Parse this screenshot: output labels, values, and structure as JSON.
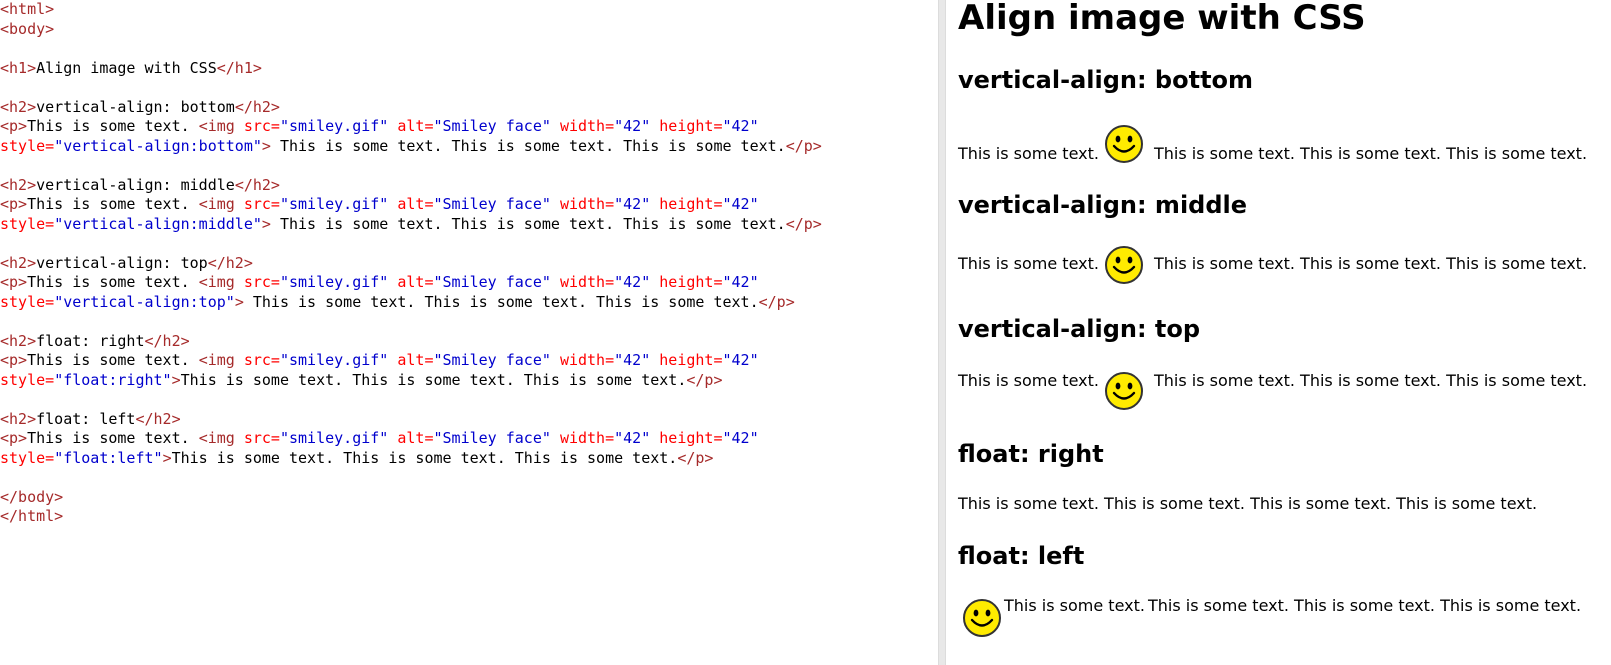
{
  "code_lines": [
    [
      {
        "c": "tag",
        "t": "<html>"
      }
    ],
    [
      {
        "c": "tag",
        "t": "<body>"
      }
    ],
    [],
    [
      {
        "c": "tag",
        "t": "<h1>"
      },
      {
        "c": "txt",
        "t": "Align image with CSS"
      },
      {
        "c": "tag",
        "t": "</h1>"
      }
    ],
    [],
    [
      {
        "c": "tag",
        "t": "<h2>"
      },
      {
        "c": "txt",
        "t": "vertical-align: bottom"
      },
      {
        "c": "tag",
        "t": "</h2>"
      }
    ],
    [
      {
        "c": "tag",
        "t": "<p>"
      },
      {
        "c": "txt",
        "t": "This is some text. "
      },
      {
        "c": "tag",
        "t": "<img "
      },
      {
        "c": "attr",
        "t": "src="
      },
      {
        "c": "val",
        "t": "\"smiley.gif\""
      },
      {
        "c": "txt",
        "t": " "
      },
      {
        "c": "attr",
        "t": "alt="
      },
      {
        "c": "val",
        "t": "\"Smiley face\""
      },
      {
        "c": "txt",
        "t": " "
      },
      {
        "c": "attr",
        "t": "width="
      },
      {
        "c": "val",
        "t": "\"42\""
      },
      {
        "c": "txt",
        "t": " "
      },
      {
        "c": "attr",
        "t": "height="
      },
      {
        "c": "val",
        "t": "\"42\""
      }
    ],
    [
      {
        "c": "attr",
        "t": "style="
      },
      {
        "c": "val",
        "t": "\"vertical-align:bottom\""
      },
      {
        "c": "tag",
        "t": ">"
      },
      {
        "c": "txt",
        "t": " This is some text. This is some text. This is some text."
      },
      {
        "c": "tag",
        "t": "</p>"
      }
    ],
    [],
    [
      {
        "c": "tag",
        "t": "<h2>"
      },
      {
        "c": "txt",
        "t": "vertical-align: middle"
      },
      {
        "c": "tag",
        "t": "</h2>"
      }
    ],
    [
      {
        "c": "tag",
        "t": "<p>"
      },
      {
        "c": "txt",
        "t": "This is some text. "
      },
      {
        "c": "tag",
        "t": "<img "
      },
      {
        "c": "attr",
        "t": "src="
      },
      {
        "c": "val",
        "t": "\"smiley.gif\""
      },
      {
        "c": "txt",
        "t": " "
      },
      {
        "c": "attr",
        "t": "alt="
      },
      {
        "c": "val",
        "t": "\"Smiley face\""
      },
      {
        "c": "txt",
        "t": " "
      },
      {
        "c": "attr",
        "t": "width="
      },
      {
        "c": "val",
        "t": "\"42\""
      },
      {
        "c": "txt",
        "t": " "
      },
      {
        "c": "attr",
        "t": "height="
      },
      {
        "c": "val",
        "t": "\"42\""
      }
    ],
    [
      {
        "c": "attr",
        "t": "style="
      },
      {
        "c": "val",
        "t": "\"vertical-align:middle\""
      },
      {
        "c": "tag",
        "t": ">"
      },
      {
        "c": "txt",
        "t": " This is some text. This is some text. This is some text."
      },
      {
        "c": "tag",
        "t": "</p>"
      }
    ],
    [],
    [
      {
        "c": "tag",
        "t": "<h2>"
      },
      {
        "c": "txt",
        "t": "vertical-align: top"
      },
      {
        "c": "tag",
        "t": "</h2>"
      }
    ],
    [
      {
        "c": "tag",
        "t": "<p>"
      },
      {
        "c": "txt",
        "t": "This is some text. "
      },
      {
        "c": "tag",
        "t": "<img "
      },
      {
        "c": "attr",
        "t": "src="
      },
      {
        "c": "val",
        "t": "\"smiley.gif\""
      },
      {
        "c": "txt",
        "t": " "
      },
      {
        "c": "attr",
        "t": "alt="
      },
      {
        "c": "val",
        "t": "\"Smiley face\""
      },
      {
        "c": "txt",
        "t": " "
      },
      {
        "c": "attr",
        "t": "width="
      },
      {
        "c": "val",
        "t": "\"42\""
      },
      {
        "c": "txt",
        "t": " "
      },
      {
        "c": "attr",
        "t": "height="
      },
      {
        "c": "val",
        "t": "\"42\""
      }
    ],
    [
      {
        "c": "attr",
        "t": "style="
      },
      {
        "c": "val",
        "t": "\"vertical-align:top\""
      },
      {
        "c": "tag",
        "t": ">"
      },
      {
        "c": "txt",
        "t": " This is some text. This is some text. This is some text."
      },
      {
        "c": "tag",
        "t": "</p>"
      }
    ],
    [],
    [
      {
        "c": "tag",
        "t": "<h2>"
      },
      {
        "c": "txt",
        "t": "float: right"
      },
      {
        "c": "tag",
        "t": "</h2>"
      }
    ],
    [
      {
        "c": "tag",
        "t": "<p>"
      },
      {
        "c": "txt",
        "t": "This is some text. "
      },
      {
        "c": "tag",
        "t": "<img "
      },
      {
        "c": "attr",
        "t": "src="
      },
      {
        "c": "val",
        "t": "\"smiley.gif\""
      },
      {
        "c": "txt",
        "t": " "
      },
      {
        "c": "attr",
        "t": "alt="
      },
      {
        "c": "val",
        "t": "\"Smiley face\""
      },
      {
        "c": "txt",
        "t": " "
      },
      {
        "c": "attr",
        "t": "width="
      },
      {
        "c": "val",
        "t": "\"42\""
      },
      {
        "c": "txt",
        "t": " "
      },
      {
        "c": "attr",
        "t": "height="
      },
      {
        "c": "val",
        "t": "\"42\""
      }
    ],
    [
      {
        "c": "attr",
        "t": "style="
      },
      {
        "c": "val",
        "t": "\"float:right\""
      },
      {
        "c": "tag",
        "t": ">"
      },
      {
        "c": "txt",
        "t": "This is some text. This is some text. This is some text."
      },
      {
        "c": "tag",
        "t": "</p>"
      }
    ],
    [],
    [
      {
        "c": "tag",
        "t": "<h2>"
      },
      {
        "c": "txt",
        "t": "float: left"
      },
      {
        "c": "tag",
        "t": "</h2>"
      }
    ],
    [
      {
        "c": "tag",
        "t": "<p>"
      },
      {
        "c": "txt",
        "t": "This is some text. "
      },
      {
        "c": "tag",
        "t": "<img "
      },
      {
        "c": "attr",
        "t": "src="
      },
      {
        "c": "val",
        "t": "\"smiley.gif\""
      },
      {
        "c": "txt",
        "t": " "
      },
      {
        "c": "attr",
        "t": "alt="
      },
      {
        "c": "val",
        "t": "\"Smiley face\""
      },
      {
        "c": "txt",
        "t": " "
      },
      {
        "c": "attr",
        "t": "width="
      },
      {
        "c": "val",
        "t": "\"42\""
      },
      {
        "c": "txt",
        "t": " "
      },
      {
        "c": "attr",
        "t": "height="
      },
      {
        "c": "val",
        "t": "\"42\""
      }
    ],
    [
      {
        "c": "attr",
        "t": "style="
      },
      {
        "c": "val",
        "t": "\"float:left\""
      },
      {
        "c": "tag",
        "t": ">"
      },
      {
        "c": "txt",
        "t": "This is some text. This is some text. This is some text."
      },
      {
        "c": "tag",
        "t": "</p>"
      }
    ],
    [],
    [
      {
        "c": "tag",
        "t": "</body>"
      }
    ],
    [
      {
        "c": "tag",
        "t": "</html>"
      }
    ]
  ],
  "preview": {
    "h1": "Align image with CSS",
    "sections": [
      {
        "heading": "vertical-align: bottom",
        "text_before": "This is some text.",
        "text_after": "This is some text. This is some text. This is some text."
      },
      {
        "heading": "vertical-align: middle",
        "text_before": "This is some text.",
        "text_after": "This is some text. This is some text. This is some text."
      },
      {
        "heading": "vertical-align: top",
        "text_before": "This is some text.",
        "text_after": "This is some text. This is some text. This is some text."
      },
      {
        "heading": "float: right",
        "text_before": "This is some text.",
        "text_after": "This is some text. This is some text. This is some text."
      },
      {
        "heading": "float: left",
        "text_before": "This is some text.",
        "text_after": "This is some text. This is some text. This is some text."
      }
    ],
    "image_icon": "smiley-face-icon",
    "image_alt": "Smiley face"
  },
  "colors": {
    "tag": "#a52a2a",
    "attr": "#ff0000",
    "value": "#0000cd",
    "text": "#000000",
    "smiley": "#ffeb00"
  }
}
